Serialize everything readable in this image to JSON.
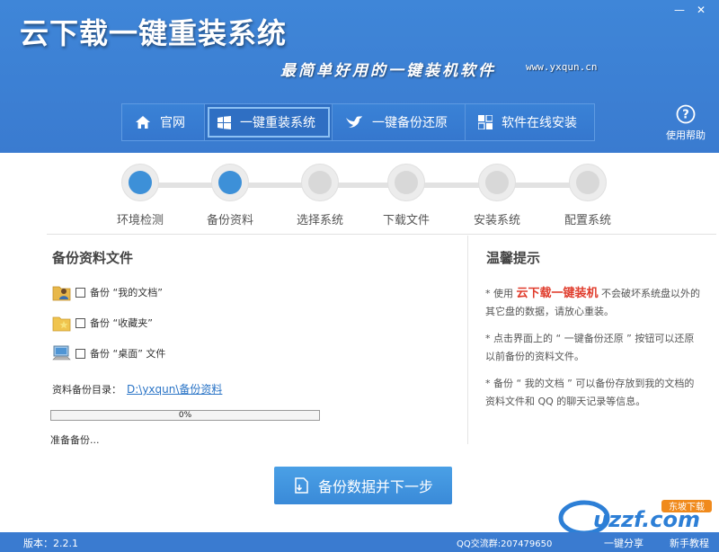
{
  "app": {
    "title": "云下载一键重装系统",
    "slogan": "最简单好用的一键装机软件",
    "site_url": "www.yxqun.cn",
    "window": {
      "minimize": "—",
      "close": "✕"
    }
  },
  "nav": {
    "items": [
      {
        "label": "官网",
        "icon": "home-icon"
      },
      {
        "label": "一键重装系统",
        "icon": "windows-icon",
        "active": true
      },
      {
        "label": "一键备份还原",
        "icon": "bird-icon"
      },
      {
        "label": "软件在线安装",
        "icon": "squares-icon"
      }
    ],
    "help_label": "使用帮助"
  },
  "steps": [
    {
      "label": "环境检测",
      "done": true
    },
    {
      "label": "备份资料",
      "done": true
    },
    {
      "label": "选择系统",
      "done": false
    },
    {
      "label": "下载文件",
      "done": false
    },
    {
      "label": "安装系统",
      "done": false
    },
    {
      "label": "配置系统",
      "done": false
    }
  ],
  "backup": {
    "title": "备份资料文件",
    "items": [
      {
        "label": "备份 “我的文档”",
        "icon": "user-folder-icon",
        "checked": false
      },
      {
        "label": "备份 “收藏夹”",
        "icon": "favorites-folder-icon",
        "checked": false
      },
      {
        "label": "备份 “桌面” 文件",
        "icon": "desktop-computer-icon",
        "checked": false
      }
    ],
    "dir_label": "资料备份目录：",
    "dir_path": "D:\\yxqun\\备份资料",
    "progress_percent": 0,
    "progress_text": "0%",
    "status": "准备备份..."
  },
  "tips": {
    "title": "温馨提示",
    "tip1_prefix": "* 使用 ",
    "tip1_highlight": "云下载一键装机",
    "tip1_suffix": " 不会破坏系统盘以外的其它盘的数据，请放心重装。",
    "tip2": "* 点击界面上的 “ 一键备份还原 ” 按钮可以还原以前备份的资料文件。",
    "tip3": "* 备份 “ 我的文档 ” 可以备份存放到我的文档的资料文件和 QQ 的聊天记录等信息。"
  },
  "next_button": "备份数据并下一步",
  "footer": {
    "version": "版本：2.2.1",
    "qq_group": "QQ交流群:207479650",
    "share": "一键分享",
    "tutorial": "新手教程",
    "badge_text": "uzzf.com",
    "badge_sub": "东坡下载"
  },
  "colors": {
    "header_blue": "#3a7bd0",
    "accent_blue": "#3d90d8",
    "highlight_red": "#e03c2c"
  }
}
